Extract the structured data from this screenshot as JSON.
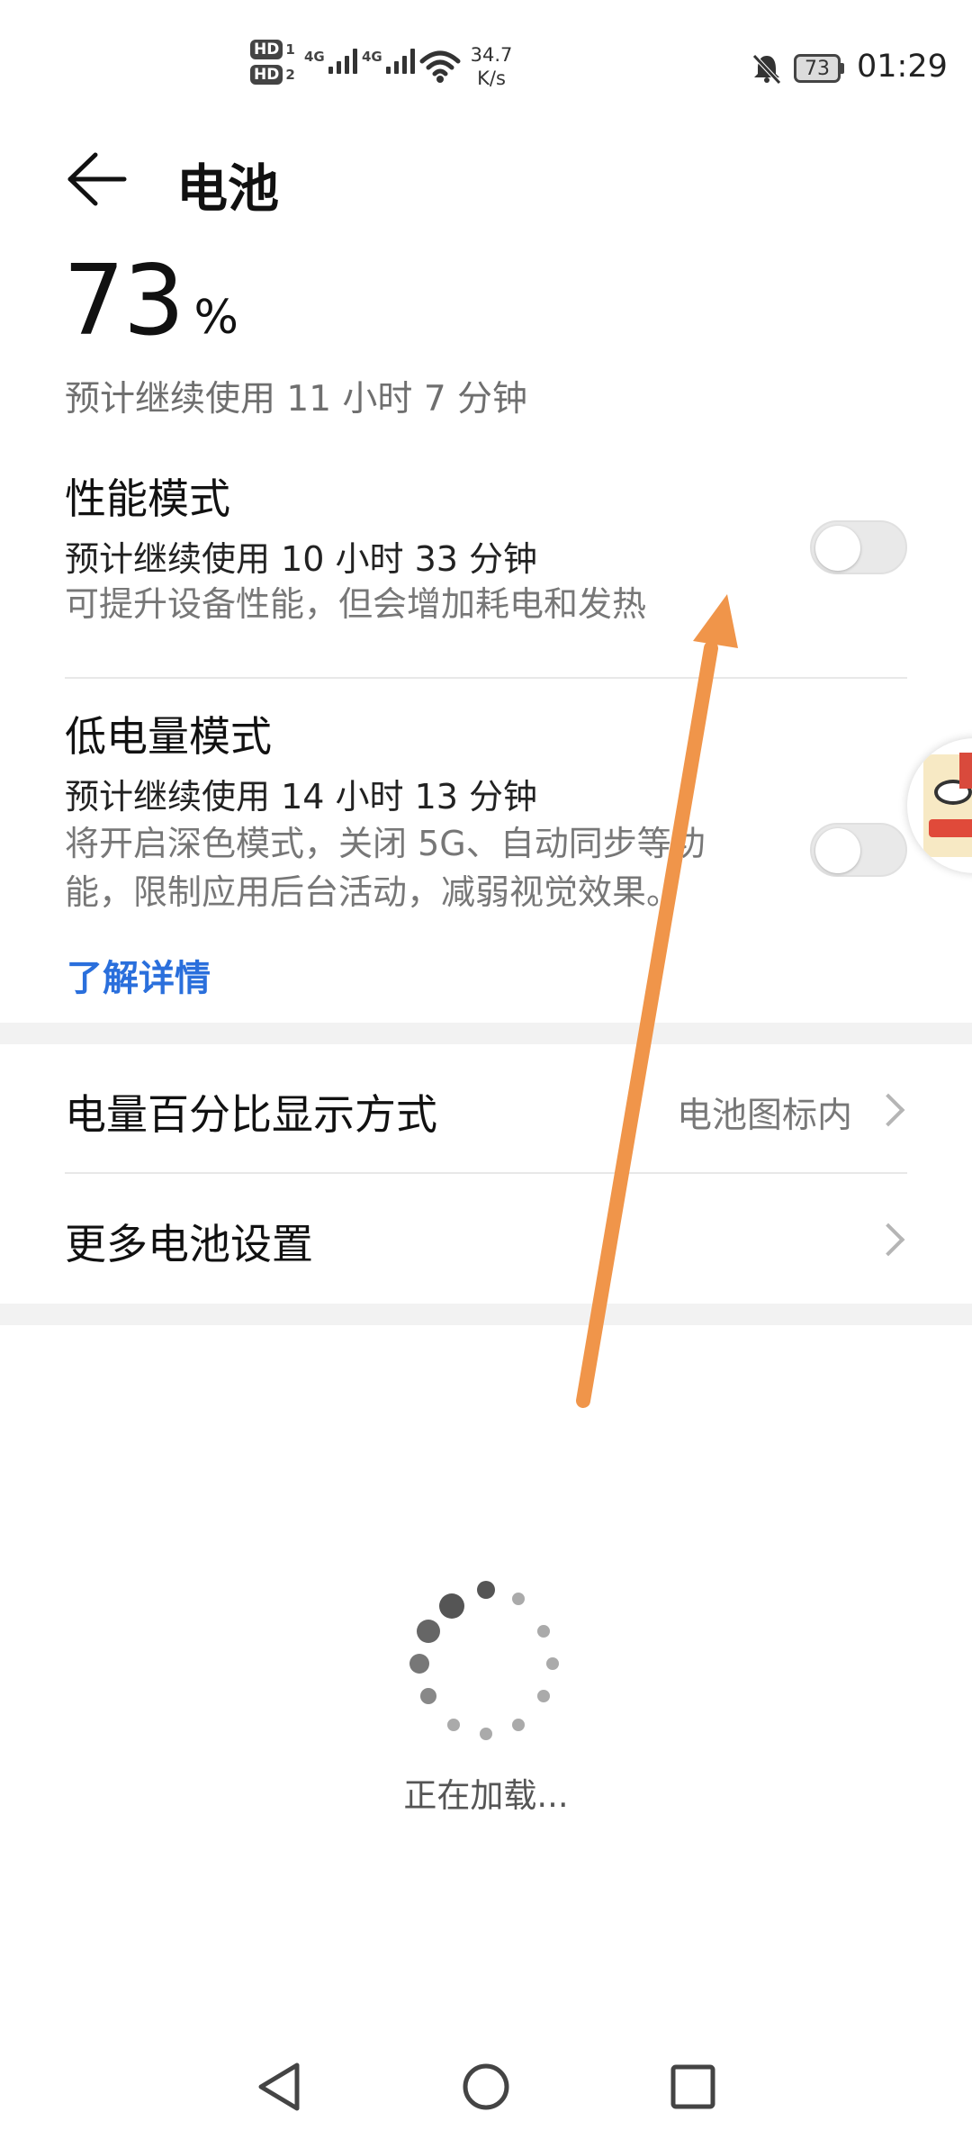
{
  "status_bar": {
    "hd1": "HD",
    "hd1_sub": "1",
    "hd2": "HD",
    "hd2_sub": "2",
    "sig1_label": "4G",
    "sig2_label": "4G",
    "net_speed_value": "34.7",
    "net_speed_unit": "K/s",
    "battery_level": "73",
    "time": "01:29"
  },
  "header": {
    "title": "电池"
  },
  "battery": {
    "percent": "73",
    "percent_sign": "%",
    "estimate": "预计继续使用 11 小时 7 分钟"
  },
  "performance_mode": {
    "title": "性能模式",
    "estimate": "预计继续使用 10 小时 33 分钟",
    "description": "可提升设备性能，但会增加耗电和发热",
    "enabled": false
  },
  "low_power_mode": {
    "title": "低电量模式",
    "estimate": "预计继续使用 14 小时 13 分钟",
    "description_line1": "将开启深色模式，关闭 5G、自动同步等功",
    "description_line2": "能，限制应用后台活动，减弱视觉效果。",
    "enabled": false,
    "learn_more": "了解详情"
  },
  "settings": [
    {
      "label": "电量百分比显示方式",
      "value": "电池图标内"
    },
    {
      "label": "更多电池设置",
      "value": ""
    }
  ],
  "loading": {
    "text": "正在加载..."
  },
  "annotation": {
    "arrow_color": "#f0954a"
  },
  "colors": {
    "accent_link": "#2a6fdc",
    "toggle_off": "#e9e9e9"
  }
}
